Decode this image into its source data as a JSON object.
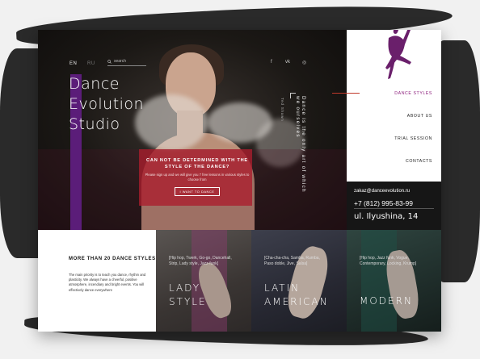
{
  "header": {
    "lang_active": "EN",
    "lang_other": "RU",
    "search_placeholder": "search",
    "social": [
      "f",
      "vk",
      "◎"
    ]
  },
  "hero": {
    "title_lines": [
      "Dance",
      "Evolution",
      "Studio"
    ],
    "tagline": "CAN NOT BE DETERMINED WITH THE STYLE OF THE DANCE?",
    "subtext": "Please sign up and we will give you 7 free lessons in various styles to choose from",
    "cta_label": "I WANT TO DANCE",
    "quote": "Dance is the only art of which we ourselves",
    "quote_attr": "Ted Shawn"
  },
  "menu": {
    "items": [
      {
        "label": "DANCE STYLES",
        "active": true
      },
      {
        "label": "ABOUT US",
        "active": false
      },
      {
        "label": "TRIAL SESSION",
        "active": false
      },
      {
        "label": "CONTACTS",
        "active": false
      }
    ]
  },
  "contact": {
    "email": "zakaz@danceevolution.ru",
    "phone": "+7 (812) 995-83-99",
    "address": "ul. Ilyushina, 14"
  },
  "info": {
    "title": "MORE THAN 20 DANCE STYLES",
    "text": "The main priority is to teach you dance, rhythm and plasticity. We always have a cheerful, positive atmosphere, incendiary and bright events. You will effectively dance everywhere"
  },
  "styles": [
    {
      "list": "[Hip hop, Twerk, Go-go, Dancehall, Strip, Lady style, Jazz-funk]",
      "name_lines": [
        "LADY",
        "STYLE"
      ]
    },
    {
      "list": "[Cha-cha-cha, Samba, Rumba, Paso doble, Jive, Salsa]",
      "name_lines": [
        "LATIN",
        "AMERICAN"
      ]
    },
    {
      "list": "[Hip hop, Jazz funk, Vogue, Contemporary, Locking, Krump]",
      "name_lines": [
        "MODERN"
      ]
    }
  ],
  "colors": {
    "accent_purple": "#5b1d79",
    "accent_red": "#aa1e2d",
    "menu_active": "#8a1a7a"
  }
}
